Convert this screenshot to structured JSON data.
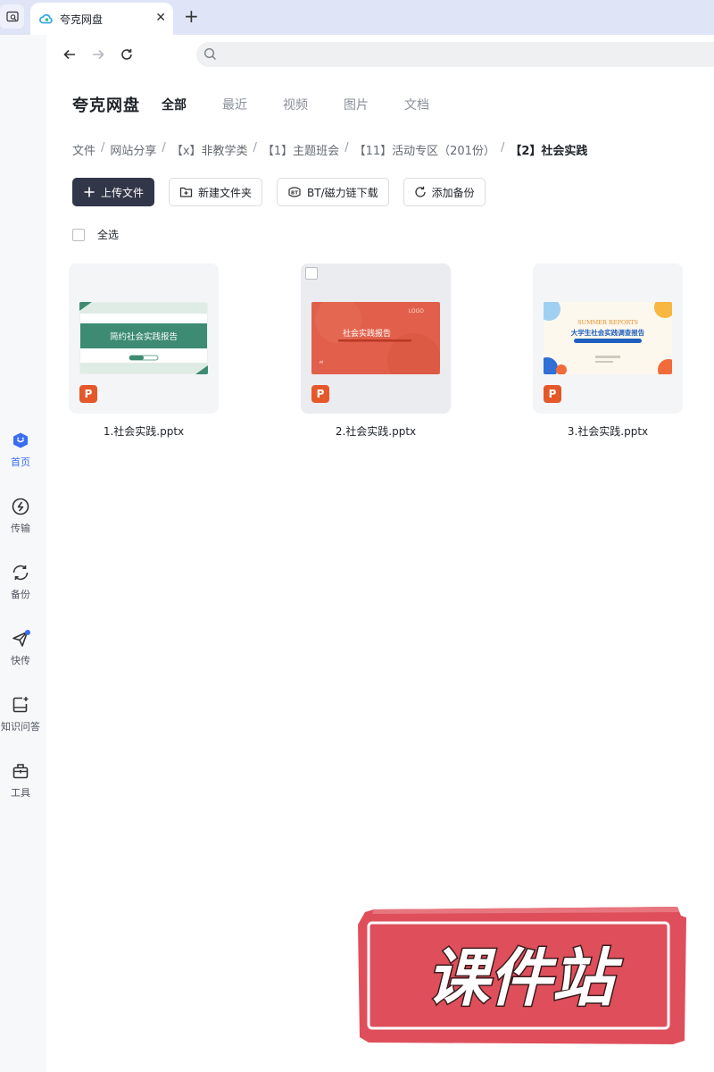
{
  "browser": {
    "tab_title": "夸克网盘",
    "address_placeholder": ""
  },
  "sidebar": {
    "items": [
      {
        "label": "首页",
        "icon": "home-icon",
        "active": true
      },
      {
        "label": "传输",
        "icon": "transfer-icon"
      },
      {
        "label": "备份",
        "icon": "backup-icon"
      },
      {
        "label": "快传",
        "icon": "quick-send-icon"
      },
      {
        "label": "知识问答",
        "icon": "knowledge-qa-icon"
      },
      {
        "label": "工具",
        "icon": "tools-icon"
      }
    ]
  },
  "header": {
    "brand": "夸克网盘",
    "tabs": [
      "全部",
      "最近",
      "视频",
      "图片",
      "文档"
    ]
  },
  "breadcrumb": [
    "文件",
    "网站分享",
    "【x】非教学类",
    "【1】主题班会",
    "【11】活动专区（201份）",
    "【2】社会实践"
  ],
  "toolbar": {
    "upload": "上传文件",
    "new_folder": "新建文件夹",
    "bt_download": "BT/磁力链下载",
    "add_backup": "添加备份"
  },
  "select_all": "全选",
  "files": [
    {
      "name": "1.社会实践.pptx",
      "thumb_title": "简约社会实践报告",
      "thumb_color": "#3d8b72"
    },
    {
      "name": "2.社会实践.pptx",
      "thumb_title": "社会实践报告",
      "thumb_logo": "LOGO",
      "thumb_color": "#e2604b"
    },
    {
      "name": "3.社会实践.pptx",
      "thumb_title": "大学生社会实践调查报告",
      "thumb_subtitle": "SUMMER REPORTS",
      "thumb_color": "#1f5fbf"
    }
  ],
  "watermark": "课件站",
  "colors": {
    "accent": "#3a6ef0",
    "primary_button": "#323649",
    "ppt_badge": "#e4582a",
    "stamp": "#de4f5b"
  }
}
